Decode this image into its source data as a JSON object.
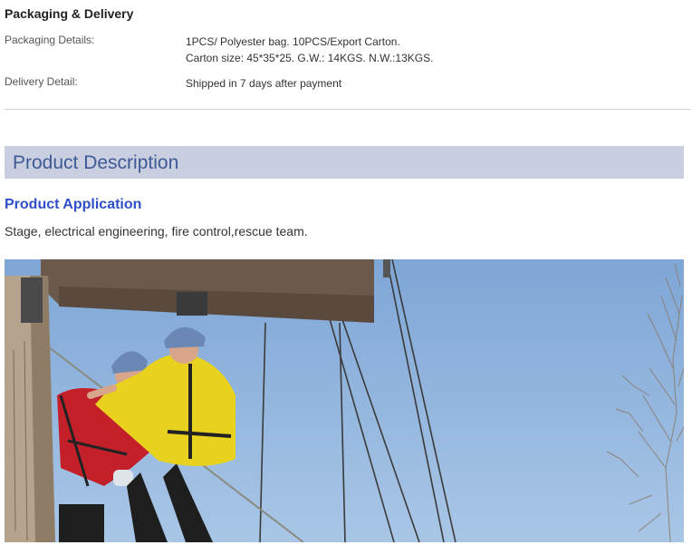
{
  "packaging": {
    "title": "Packaging & Delivery",
    "packaging_details_label": "Packaging Details:",
    "packaging_details_line1": "1PCS/ Polyester bag. 10PCS/Export Carton.",
    "packaging_details_line2": "Carton size: 45*35*25. G.W.: 14KGS. N.W.:13KGS.",
    "delivery_detail_label": "Delivery Detail:",
    "delivery_detail_value": "Shipped in 7 days after payment"
  },
  "description": {
    "header": "Product Description",
    "application_title": "Product Application",
    "application_text": "Stage, electrical engineering, fire control,rescue team."
  },
  "photo": {
    "subject": "rescue-climbers-photo",
    "sky_color": "#8fb3dc",
    "jacket_yellow": "#e8d21e",
    "jacket_red": "#c4202a",
    "helmet_blue": "#6b87b3"
  }
}
